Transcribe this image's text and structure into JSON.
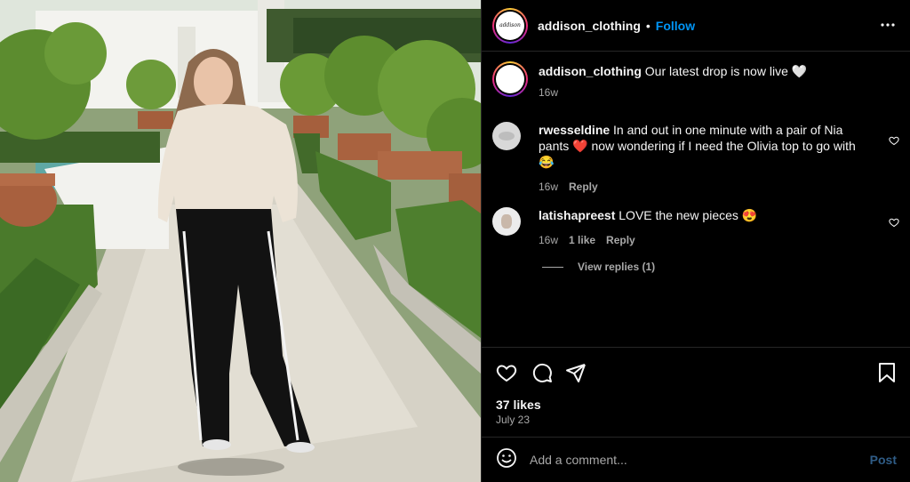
{
  "post": {
    "username": "addison_clothing",
    "separator": "•",
    "follow_label": "Follow",
    "avatar_text": "addison",
    "caption": {
      "username": "addison_clothing",
      "text": "Our latest drop is now live 🤍",
      "time": "16w"
    },
    "comments": [
      {
        "username": "rwesseldine",
        "text": "In and out in one minute with a pair of Nia pants ❤️ now wondering if I need the Olivia top to go with 😂",
        "time": "16w",
        "likes": "",
        "reply_label": "Reply"
      },
      {
        "username": "latishapreest",
        "text": "LOVE the new pieces 😍",
        "time": "16w",
        "likes": "1 like",
        "reply_label": "Reply"
      }
    ],
    "view_replies_label": "View replies (1)",
    "likes": "37 likes",
    "date": "July 23",
    "comment_placeholder": "Add a comment...",
    "post_label": "Post"
  },
  "colors": {
    "background": "#000000",
    "link_blue": "#0095f6",
    "muted_text": "#a8a8a8",
    "divider": "#262626"
  },
  "icons": [
    "more-icon",
    "heart-icon",
    "comment-icon",
    "share-icon",
    "bookmark-icon",
    "emoji-icon"
  ]
}
